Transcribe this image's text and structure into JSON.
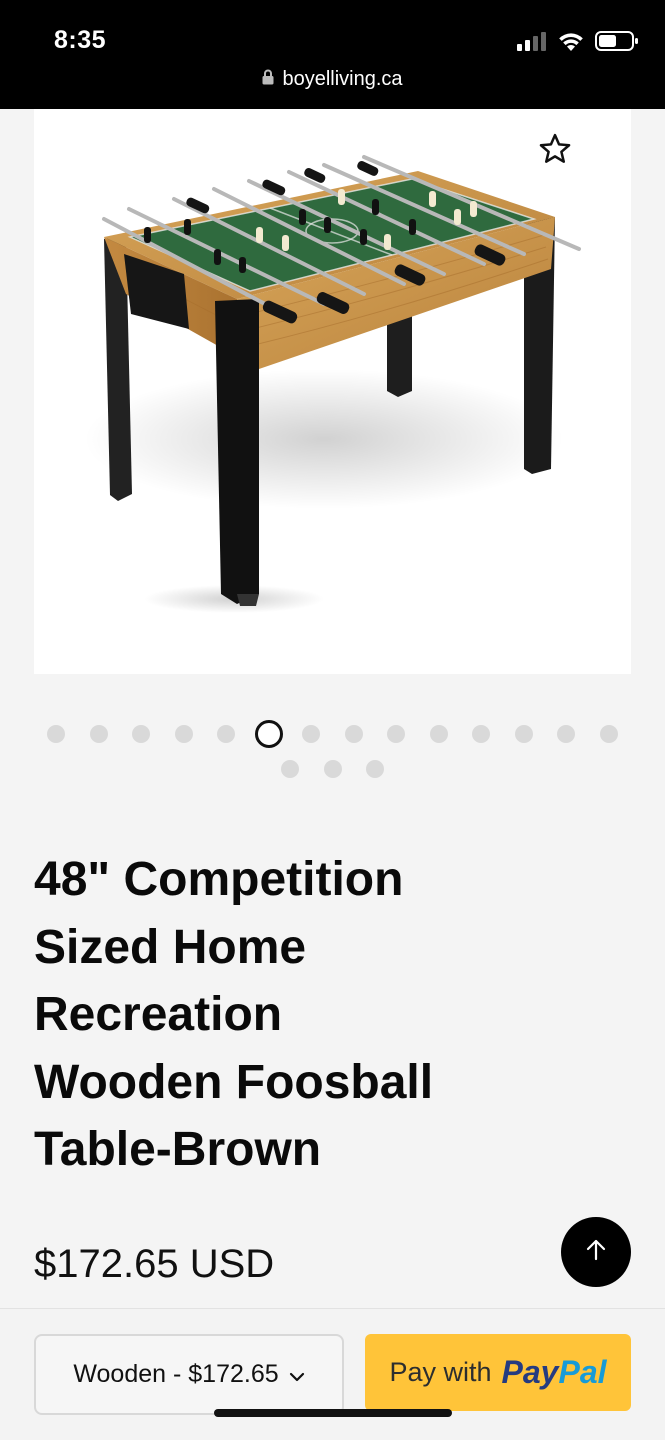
{
  "status_bar": {
    "time": "8:35",
    "icons": [
      "cellular-signal-icon",
      "wifi-icon",
      "battery-icon"
    ]
  },
  "browser": {
    "url": "boyelliving.ca",
    "lock_icon": "lock-icon"
  },
  "product": {
    "image_alt": "Wooden foosball table with black legs",
    "favorite_icon": "star-outline-icon",
    "gallery": {
      "total": 17,
      "active_index": 5
    },
    "title_lines": [
      "48\" Competition",
      "Sized Home",
      "Recreation",
      "Wooden Foosball",
      "Table-Brown"
    ],
    "price": "$172.65 USD"
  },
  "back_to_top_icon": "arrow-up-icon",
  "purchase_bar": {
    "variant_selected": "Wooden - $172.65",
    "variant_icon": "chevron-down-icon",
    "paypal_prefix": "Pay with",
    "paypal_brand_part1": "Pay",
    "paypal_brand_part2": "Pal"
  },
  "colors": {
    "paypal_yellow": "#ffc439",
    "paypal_dark_blue": "#253b80",
    "paypal_light_blue": "#179bd7"
  }
}
